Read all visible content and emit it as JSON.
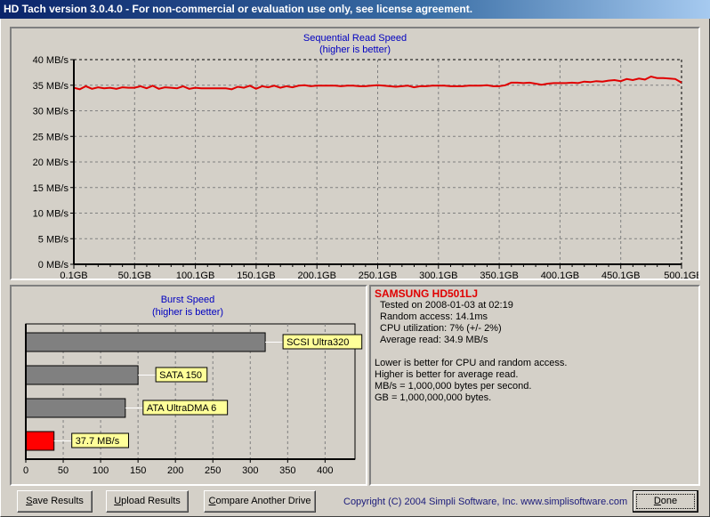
{
  "window": {
    "title": "HD Tach version 3.0.4.0  - For non-commercial or evaluation use only, see license agreement."
  },
  "sequential_chart": {
    "title": "Sequential Read Speed",
    "subtitle": "(higher is better)"
  },
  "burst_chart": {
    "title": "Burst Speed",
    "subtitle": "(higher is better)"
  },
  "chart_data": [
    {
      "type": "line",
      "title": "Sequential Read Speed",
      "subtitle": "(higher is better)",
      "xlabel": "",
      "ylabel": "",
      "x_ticks": [
        "0,1GB",
        "50,1GB",
        "100,1GB",
        "150,1GB",
        "200,1GB",
        "250,1GB",
        "300,1GB",
        "350,1GB",
        "400,1GB",
        "450,1GB",
        "500,1GB"
      ],
      "y_ticks": [
        "0 MB/s",
        "5 MB/s",
        "10 MB/s",
        "15 MB/s",
        "20 MB/s",
        "25 MB/s",
        "30 MB/s",
        "35 MB/s",
        "40 MB/s"
      ],
      "xlim": [
        0.1,
        500.1
      ],
      "ylim": [
        0,
        40
      ],
      "grid": true,
      "series": [
        {
          "name": "Read speed",
          "color": "#e00000",
          "x": [
            0.1,
            5,
            10,
            15,
            20,
            25,
            30,
            35,
            40,
            45,
            50,
            55,
            60,
            65,
            70,
            75,
            80,
            85,
            90,
            95,
            100,
            105,
            110,
            115,
            120,
            125,
            130,
            135,
            140,
            145,
            150,
            155,
            160,
            165,
            170,
            175,
            180,
            185,
            190,
            195,
            200,
            205,
            210,
            215,
            220,
            225,
            230,
            235,
            240,
            245,
            250,
            255,
            260,
            265,
            270,
            275,
            280,
            285,
            290,
            295,
            300,
            305,
            310,
            315,
            320,
            325,
            330,
            335,
            340,
            345,
            350,
            355,
            360,
            365,
            370,
            375,
            380,
            385,
            390,
            395,
            400,
            405,
            410,
            415,
            420,
            425,
            430,
            435,
            440,
            445,
            450,
            455,
            460,
            465,
            470,
            475,
            480,
            485,
            490,
            495,
            500.1
          ],
          "values": [
            34.5,
            34.2,
            34.8,
            34.3,
            34.6,
            34.4,
            34.5,
            34.3,
            34.6,
            34.5,
            34.5,
            34.8,
            34.4,
            34.9,
            34.3,
            34.6,
            34.5,
            34.4,
            34.8,
            34.3,
            34.5,
            34.4,
            34.4,
            34.4,
            34.4,
            34.4,
            34.2,
            34.7,
            34.5,
            34.9,
            34.3,
            34.8,
            34.6,
            34.9,
            34.5,
            34.8,
            34.6,
            34.9,
            35.0,
            34.8,
            34.9,
            34.9,
            34.9,
            34.9,
            34.8,
            34.9,
            34.9,
            34.8,
            34.8,
            34.9,
            35.0,
            34.9,
            34.8,
            34.7,
            34.8,
            34.9,
            34.6,
            34.8,
            34.8,
            34.9,
            34.9,
            34.9,
            34.8,
            34.8,
            34.8,
            34.9,
            34.9,
            34.9,
            35.0,
            34.8,
            34.8,
            35.0,
            35.5,
            35.5,
            35.4,
            35.5,
            35.3,
            35.1,
            35.3,
            35.4,
            35.4,
            35.4,
            35.5,
            35.4,
            35.7,
            35.6,
            35.8,
            35.7,
            35.9,
            36.0,
            35.8,
            36.2,
            36.0,
            36.3,
            36.1,
            36.7,
            36.4,
            36.4,
            36.3,
            36.2,
            35.5
          ]
        }
      ]
    },
    {
      "type": "bar",
      "orientation": "horizontal",
      "title": "Burst Speed",
      "subtitle": "(higher is better)",
      "categories": [
        "SCSI Ultra320",
        "SATA 150",
        "ATA UltraDMA 6",
        "37.7 MB/s"
      ],
      "values": [
        320,
        150,
        133,
        37.7
      ],
      "colors": [
        "#808080",
        "#808080",
        "#808080",
        "#ff0000"
      ],
      "x_ticks": [
        "0",
        "50",
        "100",
        "150",
        "200",
        "250",
        "300",
        "350",
        "400"
      ],
      "xlim": [
        0,
        440
      ],
      "grid": true,
      "label_bg": "#ffff99"
    }
  ],
  "info": {
    "drive_name": "SAMSUNG HD501LJ",
    "tested_on": "Tested on 2008-01-03 at 02:19",
    "random_access": "Random access: 14.1ms",
    "cpu_utilization": "CPU utilization: 7% (+/- 2%)",
    "average_read": "Average read: 34.9 MB/s",
    "notes": [
      "Lower is better for CPU and random access.",
      "Higher is better for average read.",
      "MB/s = 1,000,000 bytes per second.",
      "GB = 1,000,000,000 bytes."
    ]
  },
  "buttons": {
    "save": {
      "mnemonic": "S",
      "rest": "ave Results"
    },
    "upload": {
      "mnemonic": "U",
      "rest": "pload Results"
    },
    "compare": {
      "mnemonic": "C",
      "rest": "ompare Another Drive"
    },
    "done": {
      "mnemonic": "D",
      "rest": "one"
    }
  },
  "footer": {
    "copyright": "Copyright (C) 2004 Simpli Software, Inc. www.simplisoftware.com"
  }
}
